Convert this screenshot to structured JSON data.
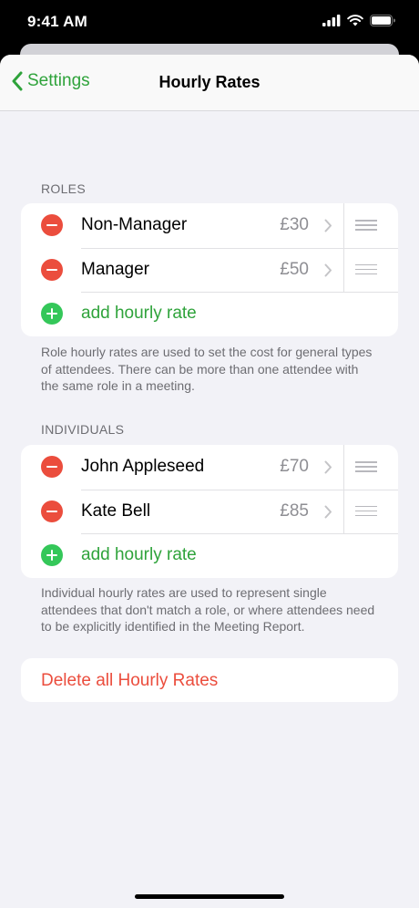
{
  "status": {
    "time": "9:41 AM"
  },
  "nav": {
    "back_label": "Settings",
    "title": "Hourly Rates"
  },
  "roles": {
    "header": "ROLES",
    "items": [
      {
        "name": "Non-Manager",
        "rate": "£30"
      },
      {
        "name": "Manager",
        "rate": "£50"
      }
    ],
    "add_label": "add hourly rate",
    "footer": "Role hourly rates are used to set the cost for general types of attendees. There can be more than one attendee with the same role in a meeting."
  },
  "individuals": {
    "header": "INDIVIDUALS",
    "items": [
      {
        "name": "John Appleseed",
        "rate": "£70"
      },
      {
        "name": "Kate Bell",
        "rate": "£85"
      }
    ],
    "add_label": "add hourly rate",
    "footer": "Individual hourly rates are used to represent single attendees that don't match a role, or where attendees need to be explicitly identified in the Meeting Report."
  },
  "delete_label": "Delete all Hourly Rates",
  "colors": {
    "accent": "#2fa33b",
    "destructive": "#eb4d3d",
    "add": "#34c759",
    "background": "#f2f2f7"
  },
  "icons": {
    "back": "chevron-left-icon",
    "signal": "cellular-signal-icon",
    "wifi": "wifi-icon",
    "battery": "battery-icon",
    "row": "chevron-right-icon",
    "reorder": "drag-handle-icon"
  }
}
